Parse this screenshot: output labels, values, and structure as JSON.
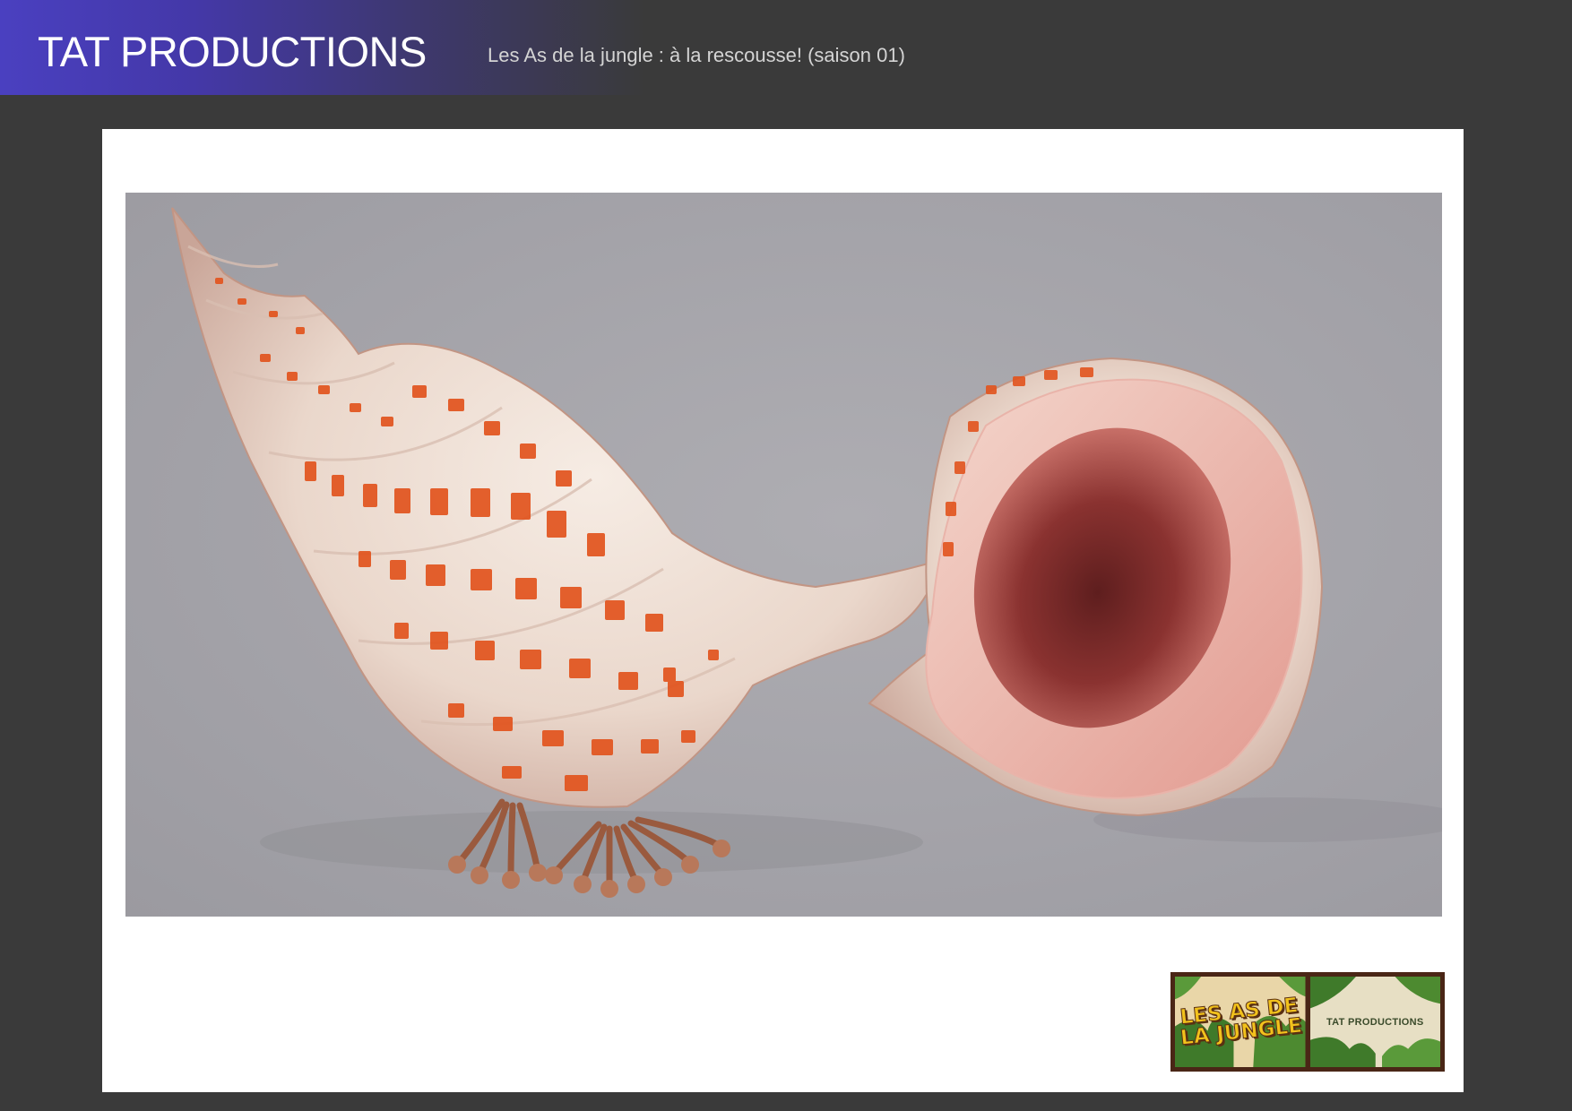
{
  "header": {
    "brand": "TAT PRODUCTIONS",
    "project_title": "Les As de la jungle : à la rescousse! (saison 01)"
  },
  "render": {
    "subject": "hermit-crab-shell-prop-renders",
    "colors": {
      "background": "#a4a3a9",
      "shell_base": "#ecdcd0",
      "shell_spots": "#e2541e",
      "shell_inner": "#e8a8a0",
      "shell_cavity": "#7a2a28",
      "legs": "#b0704e"
    }
  },
  "logos": {
    "left_text": "LES AS DE LA JUNGLE",
    "right_text": "TAT PRODUCTIONS"
  }
}
